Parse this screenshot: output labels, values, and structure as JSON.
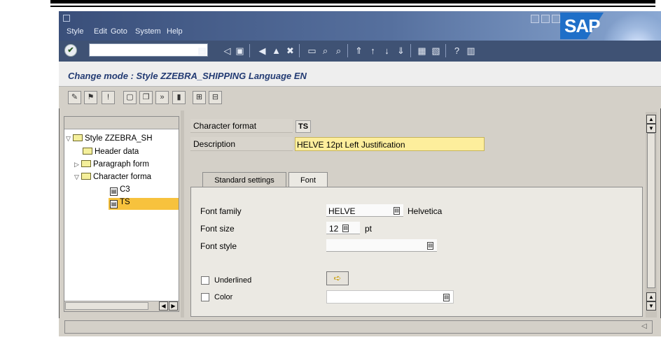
{
  "menu": {
    "items": [
      "Style",
      "Edit",
      "Goto",
      "System",
      "Help"
    ],
    "underline": [
      "",
      "E",
      "G",
      "",
      "H"
    ]
  },
  "brand": "SAP",
  "header": {
    "title": "Change mode : Style ZZEBRA_SHIPPING Language EN"
  },
  "command_field": {
    "value": ""
  },
  "tree": {
    "root": "Style ZZEBRA_SH",
    "items": [
      {
        "label": "Header data",
        "level": 1
      },
      {
        "label": "Paragraph form",
        "level": 1
      },
      {
        "label": "Character forma",
        "level": 1
      },
      {
        "label": "C3",
        "level": 2
      },
      {
        "label": "TS",
        "level": 2,
        "selected": true
      }
    ]
  },
  "form": {
    "character_format_label": "Character format",
    "character_format_value": "TS",
    "description_label": "Description",
    "description_value": "HELVE 12pt Left Justification"
  },
  "tabs": [
    {
      "label": "Standard settings",
      "active": false
    },
    {
      "label": "Font",
      "active": true
    }
  ],
  "font_tab": {
    "font_family_label": "Font family",
    "font_family_value": "HELVE",
    "font_family_text": "Helvetica",
    "font_size_label": "Font size",
    "font_size_value": "12",
    "font_size_unit": "pt",
    "font_style_label": "Font style",
    "font_style_value": "",
    "underlined_label": "Underlined",
    "color_label": "Color",
    "color_value": ""
  },
  "colors": {
    "title_bar": "#3a4f7a",
    "header_title": "#233b73",
    "selection": "#f7c23d",
    "required_field": "#fdee9c"
  }
}
